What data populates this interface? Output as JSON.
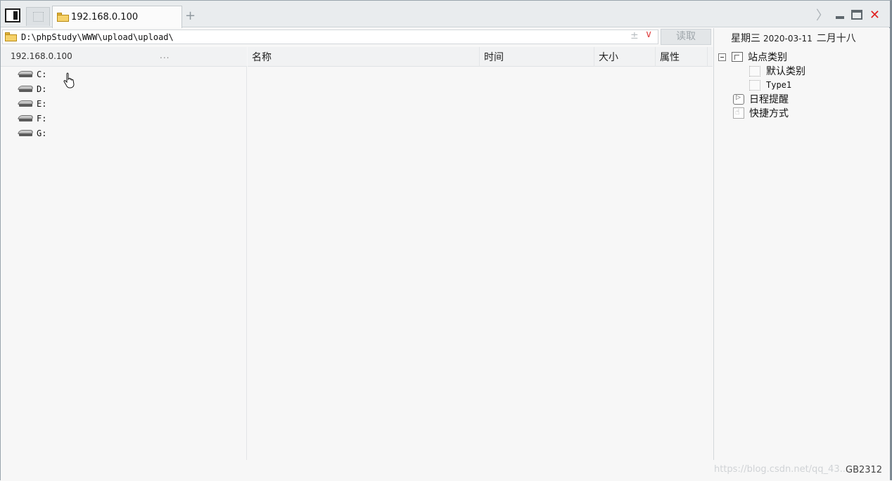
{
  "tabs": [
    {
      "label": "192.168.0.100"
    }
  ],
  "tab_add": "+",
  "window_controls": {
    "next": "〉",
    "close": "✕"
  },
  "address": {
    "path": "D:\\phpStudy\\WWW\\upload\\upload\\",
    "plus_minus": "±",
    "dropdown": "∨",
    "read_button": "读取"
  },
  "left": {
    "host": "192.168.0.100",
    "more": "...",
    "drives": [
      {
        "label": "C:"
      },
      {
        "label": "D:"
      },
      {
        "label": "E:"
      },
      {
        "label": "F:"
      },
      {
        "label": "G:"
      }
    ]
  },
  "list": {
    "columns": [
      "名称",
      "时间",
      "大小",
      "属性"
    ]
  },
  "right": {
    "weekday": "星期三",
    "date": "2020-03-11",
    "lunar": "二月十八",
    "tree": {
      "site_category": "站点类别",
      "default_category": "默认类别",
      "type1": "Type1",
      "schedule": "日程提醒",
      "shortcut": "快捷方式"
    }
  },
  "footer": {
    "watermark": "https://blog.csdn.net/qq_43...",
    "version": "GB2312"
  }
}
